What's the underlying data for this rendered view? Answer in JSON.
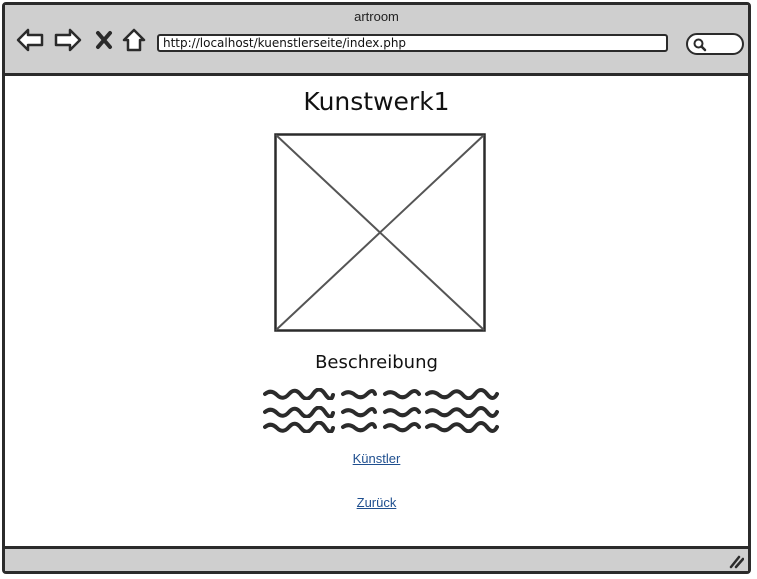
{
  "window": {
    "title": "artroom"
  },
  "toolbar": {
    "back_icon": "arrow-left-icon",
    "forward_icon": "arrow-right-icon",
    "stop_icon": "close-icon",
    "home_icon": "home-icon",
    "url": "http://localhost/kuenstlerseite/index.php",
    "search_icon": "search-icon"
  },
  "main": {
    "title": "Kunstwerk1",
    "image_icon": "image-placeholder-icon",
    "description_heading": "Beschreibung",
    "links": {
      "artist": "Künstler",
      "back": "Zurück"
    }
  },
  "colors": {
    "chrome": "#cfcfcf",
    "border": "#2b2b2b",
    "link": "#1f4f8f"
  }
}
